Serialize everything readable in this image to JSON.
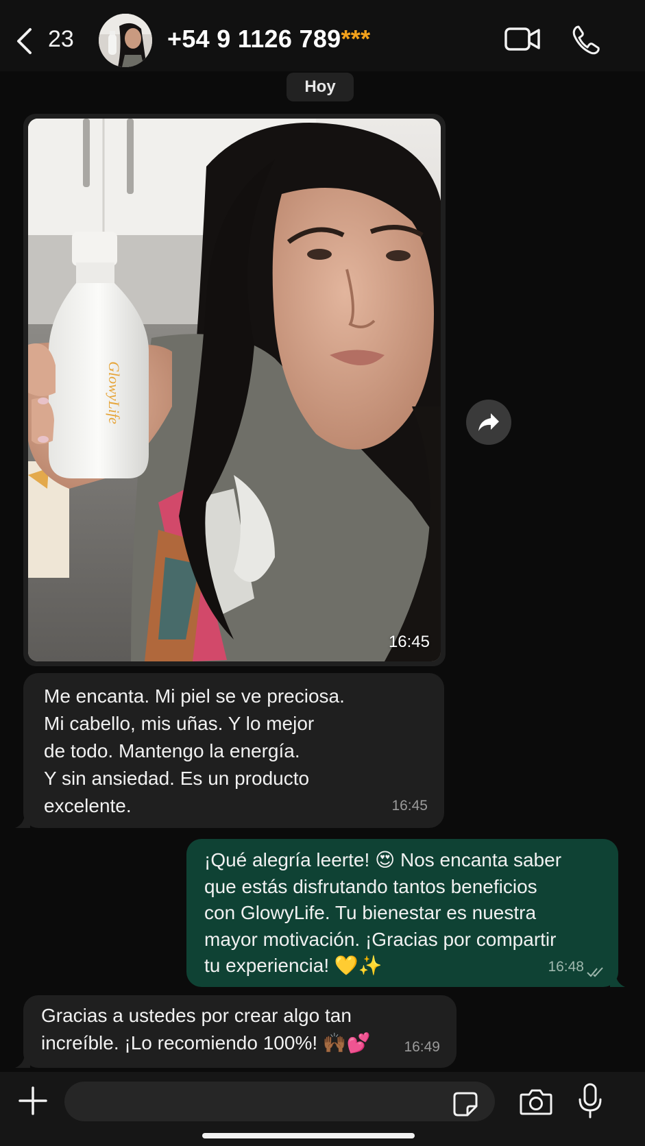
{
  "header": {
    "back_icon": "chevron-left-icon",
    "unread_count": "23",
    "contact_number": "+54 9 1126 789",
    "contact_mask": "***",
    "video_icon": "video-call-icon",
    "call_icon": "phone-call-icon"
  },
  "chat": {
    "date_label": "Hoy",
    "messages": [
      {
        "type": "image",
        "direction": "incoming",
        "time": "16:45",
        "description_icon": "photo-thumbnail",
        "bottle_label": "GlowyLife"
      },
      {
        "type": "text",
        "direction": "incoming",
        "text": "Me encanta. Mi piel se ve preciosa.\nMi cabello, mis uñas. Y lo mejor\nde todo. Mantengo la energía.\nY sin ansiedad. Es un producto\nexcelente.",
        "time": "16:45"
      },
      {
        "type": "text",
        "direction": "outgoing",
        "text": "¡Qué alegría leerte! 😍 Nos encanta saber\nque estás disfrutando tantos beneficios\ncon GlowyLife. Tu bienestar es nuestra\nmayor motivación. ¡Gracias por compartir\ntu experiencia! 💛✨",
        "time": "16:48",
        "status": "read"
      },
      {
        "type": "text",
        "direction": "incoming",
        "text": "Gracias a ustedes por crear algo tan\nincreíble. ¡Lo recomiendo 100%! 🙌🏾💕",
        "time": "16:49"
      }
    ]
  },
  "composer": {
    "plus_icon": "plus-icon",
    "sticker_icon": "sticker-icon",
    "camera_icon": "camera-icon",
    "mic_icon": "microphone-icon"
  },
  "colors": {
    "background": "#0b0b0b",
    "incoming_bubble": "#1f1f1f",
    "outgoing_bubble": "#0f4234",
    "accent_mask": "#f3a11b"
  }
}
